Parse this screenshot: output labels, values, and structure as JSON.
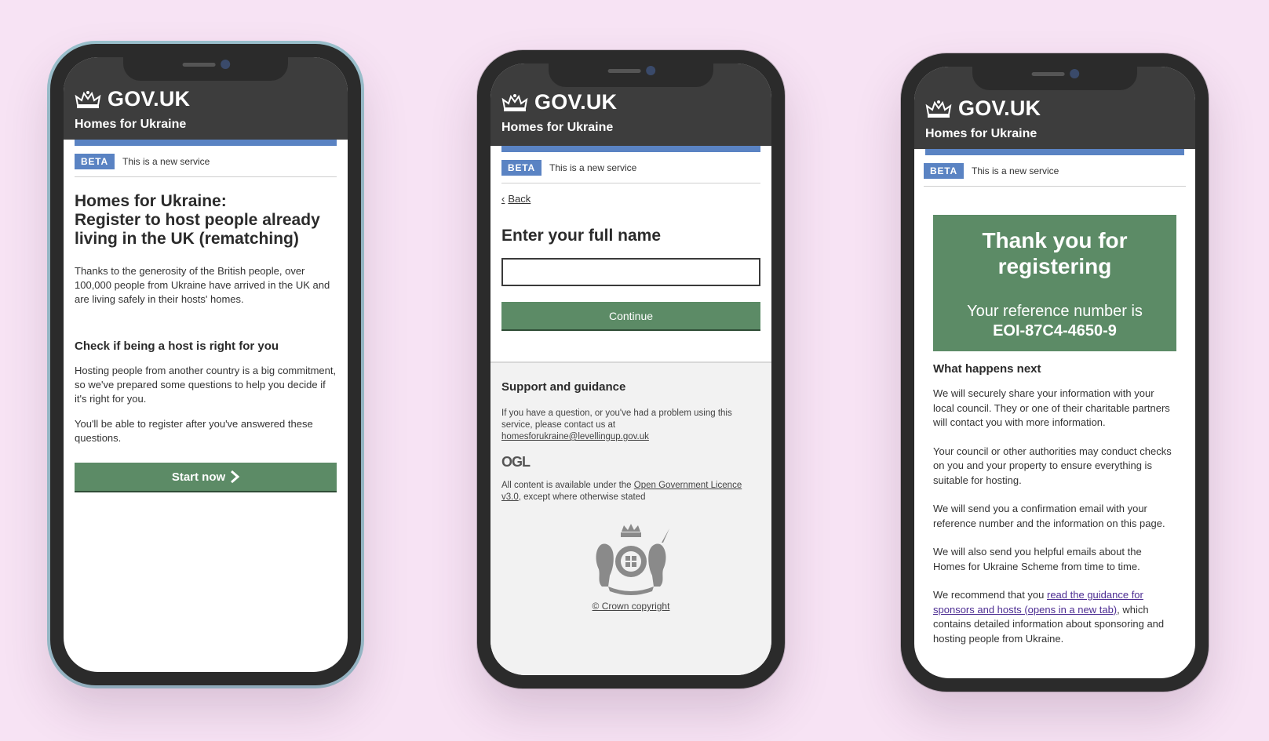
{
  "brand": {
    "logo_text": "GOV.UK",
    "service_name": "Homes for Ukraine",
    "accent": "#5a83c3",
    "button_color": "#5c8b66",
    "header_bg": "#3d3d3d"
  },
  "phase": {
    "tag": "BETA",
    "text": "This is a new service"
  },
  "screen1": {
    "title": "Homes for Ukraine:\nRegister to host people already living in the UK (rematching)",
    "intro": "Thanks to the generosity of the British people, over 100,000 people from Ukraine have arrived in the UK and are living safely in their hosts' homes.",
    "subheading": "Check if being a host is right for you",
    "para1": "Hosting people from another country is a big commitment, so we've prepared some questions to help you decide if it's right for you.",
    "para2": "You'll be able to register after you've answered these questions.",
    "start_button": "Start now"
  },
  "screen2": {
    "back_link": "Back",
    "question": "Enter your full name",
    "input_value": "",
    "continue_button": "Continue",
    "footer": {
      "heading": "Support and guidance",
      "contact_text": "If you have a question, or you've had a problem using this service, please contact us at",
      "contact_email": "homesforukraine@levellingup.gov.uk",
      "ogl_logo": "OGL",
      "licence_prefix": "All content is available under the ",
      "licence_link": "Open Government Licence v3.0",
      "licence_suffix": ", except where otherwise stated",
      "copyright": "© Crown copyright"
    }
  },
  "screen3": {
    "panel_title": "Thank you for registering",
    "ref_label": "Your reference number is",
    "ref_number": "EOI-87C4-4650-9",
    "next_heading": "What happens next",
    "p1": "We will securely share your information with your local council. They or one of their charitable partners will contact you with more information.",
    "p2": "Your council or other authorities may conduct checks on you and your property to ensure everything is suitable for hosting.",
    "p3": "We will send you a confirmation email with your reference number and the information on this page.",
    "p4": "We will also send you helpful emails about the Homes for Ukraine Scheme from time to time.",
    "p5_prefix": "We recommend that you ",
    "p5_link": "read the guidance for sponsors and hosts (opens in a new tab)",
    "p5_suffix": ", which contains detailed information about sponsoring and hosting people from Ukraine."
  }
}
